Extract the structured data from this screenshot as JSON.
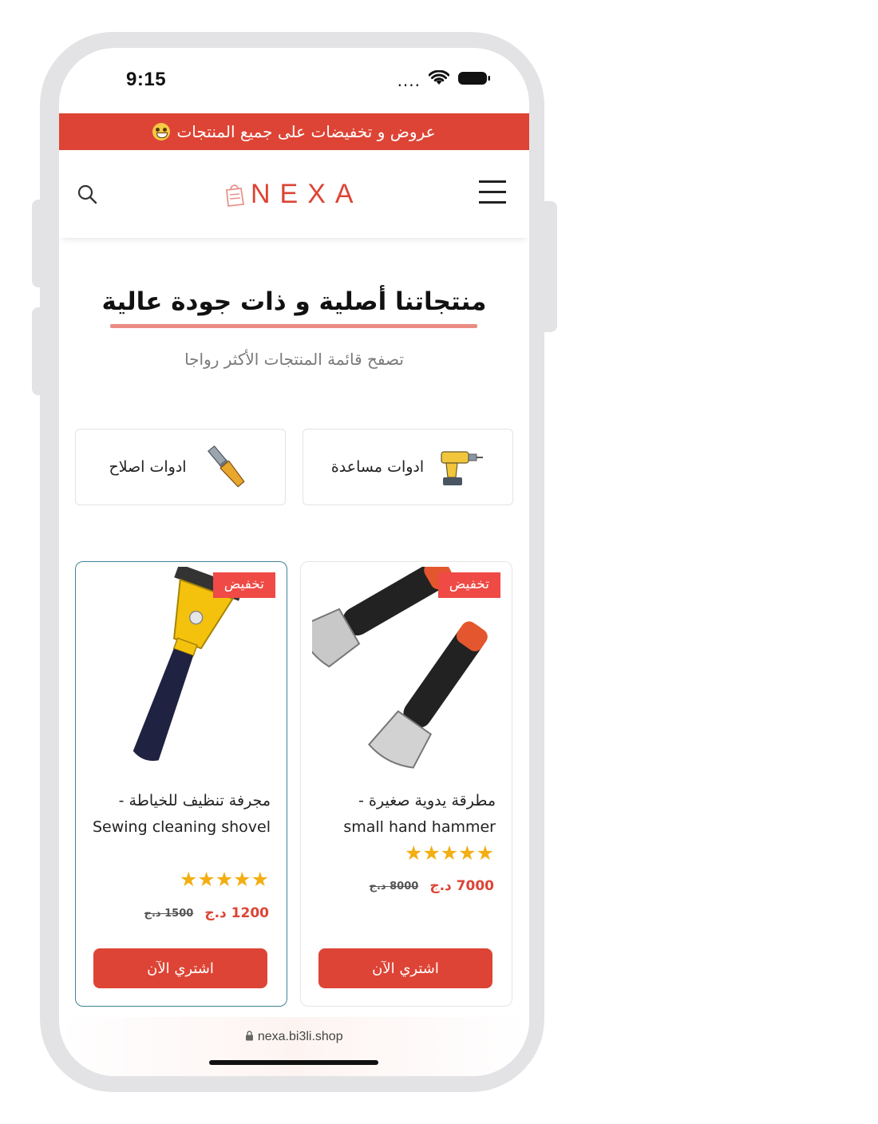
{
  "status_bar": {
    "time": "9:15",
    "signal": "...."
  },
  "promo_banner": {
    "text": "عروض و تخفيضات على جميع المنتجات"
  },
  "header": {
    "logo_text": "NEXA"
  },
  "hero": {
    "title": "منتجاتنا أصلية و ذات جودة عالية",
    "subtitle": "تصفح قائمة المنتجات الأكثر رواجا"
  },
  "categories": [
    {
      "label": "ادوات مساعدة",
      "icon": "drill-icon"
    },
    {
      "label": "ادوات اصلاح",
      "icon": "chisel-icon"
    }
  ],
  "products": [
    {
      "badge": "تخفيض",
      "name": "مطرقة يدوية صغيرة - small hand hammer",
      "rating_stars": "★★★★★",
      "rating": 5,
      "price_new": "7000 د.ج",
      "price_old": "8000 د.ج",
      "buy_label": "اشتري الآن",
      "image_icon": "hammer-icon"
    },
    {
      "badge": "تخفيض",
      "name": "مجرفة تنظيف للخياطة - Sewing cleaning shovel",
      "rating_stars": "★★★★★",
      "rating": 5,
      "price_new": "1200 د.ج",
      "price_old": "1500 د.ج",
      "buy_label": "اشتري الآن",
      "image_icon": "scraper-icon"
    }
  ],
  "url_bar": {
    "url": "nexa.bi3li.shop"
  },
  "colors": {
    "accent": "#dd4435",
    "stars": "#f3ae13",
    "selected_border": "#3f8398"
  }
}
